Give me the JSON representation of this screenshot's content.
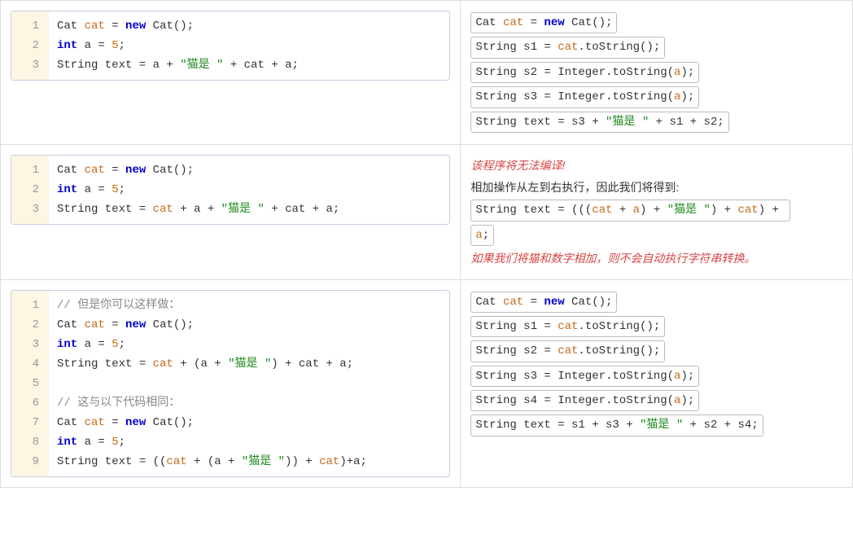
{
  "rows": [
    {
      "left": {
        "lines": [
          [
            {
              "t": "Cat ",
              "c": "typ"
            },
            {
              "t": "cat",
              "c": "var"
            },
            {
              "t": " = ",
              "c": "op"
            },
            {
              "t": "new",
              "c": "kw"
            },
            {
              "t": " Cat();",
              "c": "typ"
            }
          ],
          [
            {
              "t": "int",
              "c": "kw"
            },
            {
              "t": " a = ",
              "c": "op"
            },
            {
              "t": "5",
              "c": "num"
            },
            {
              "t": ";",
              "c": "op"
            }
          ],
          [
            {
              "t": "String text = a + ",
              "c": "op"
            },
            {
              "t": "\"猫是 \"",
              "c": "str"
            },
            {
              "t": " + cat + a;",
              "c": "op"
            }
          ]
        ]
      },
      "right": [
        {
          "type": "code",
          "tokens": [
            {
              "t": "Cat ",
              "c": "typ"
            },
            {
              "t": "cat",
              "c": "var"
            },
            {
              "t": " = ",
              "c": "op"
            },
            {
              "t": "new",
              "c": "kw"
            },
            {
              "t": " Cat();",
              "c": "typ"
            }
          ]
        },
        {
          "type": "code",
          "tokens": [
            {
              "t": "String s1 = ",
              "c": "op"
            },
            {
              "t": "cat",
              "c": "var"
            },
            {
              "t": ".toString();",
              "c": "op"
            }
          ]
        },
        {
          "type": "code",
          "tokens": [
            {
              "t": "String s2 = Integer.toString(",
              "c": "op"
            },
            {
              "t": "a",
              "c": "var"
            },
            {
              "t": ");",
              "c": "op"
            }
          ]
        },
        {
          "type": "code",
          "tokens": [
            {
              "t": "String s3 = Integer.toString(",
              "c": "op"
            },
            {
              "t": "a",
              "c": "var"
            },
            {
              "t": ");",
              "c": "op"
            }
          ]
        },
        {
          "type": "code",
          "tokens": [
            {
              "t": "String text = s3 + ",
              "c": "op"
            },
            {
              "t": "\"猫是 \"",
              "c": "str"
            },
            {
              "t": " + s1 + s2;",
              "c": "op"
            }
          ]
        }
      ]
    },
    {
      "left": {
        "lines": [
          [
            {
              "t": "Cat ",
              "c": "typ"
            },
            {
              "t": "cat",
              "c": "var"
            },
            {
              "t": " = ",
              "c": "op"
            },
            {
              "t": "new",
              "c": "kw"
            },
            {
              "t": " Cat();",
              "c": "typ"
            }
          ],
          [
            {
              "t": "int",
              "c": "kw"
            },
            {
              "t": " a = ",
              "c": "op"
            },
            {
              "t": "5",
              "c": "num"
            },
            {
              "t": ";",
              "c": "op"
            }
          ],
          [
            {
              "t": "String text = ",
              "c": "op"
            },
            {
              "t": "cat",
              "c": "var"
            },
            {
              "t": " + a + ",
              "c": "op"
            },
            {
              "t": "\"猫是 \"",
              "c": "str"
            },
            {
              "t": " + cat + a;",
              "c": "op"
            }
          ]
        ]
      },
      "right": [
        {
          "type": "err",
          "text": "该程序将无法编译!"
        },
        {
          "type": "plain",
          "text": "相加操作从左到右执行，因此我们将得到:"
        },
        {
          "type": "code",
          "tokens": [
            {
              "t": "String text = (((",
              "c": "op"
            },
            {
              "t": "cat",
              "c": "var"
            },
            {
              "t": " + ",
              "c": "op"
            },
            {
              "t": "a",
              "c": "var"
            },
            {
              "t": ") + ",
              "c": "op"
            },
            {
              "t": "\"猫是 \"",
              "c": "str"
            },
            {
              "t": ") + ",
              "c": "op"
            },
            {
              "t": "cat",
              "c": "var"
            },
            {
              "t": ") + ",
              "c": "op"
            }
          ]
        },
        {
          "type": "code",
          "tokens": [
            {
              "t": "a",
              "c": "var"
            },
            {
              "t": ";",
              "c": "op"
            }
          ]
        },
        {
          "type": "err",
          "text": "如果我们将猫和数字相加，则不会自动执行字符串转换。"
        }
      ]
    },
    {
      "left": {
        "lines": [
          [
            {
              "t": "// 但是你可以这样做：",
              "c": "cmt"
            }
          ],
          [
            {
              "t": "Cat ",
              "c": "typ"
            },
            {
              "t": "cat",
              "c": "var"
            },
            {
              "t": " = ",
              "c": "op"
            },
            {
              "t": "new",
              "c": "kw"
            },
            {
              "t": " Cat();",
              "c": "typ"
            }
          ],
          [
            {
              "t": "int",
              "c": "kw"
            },
            {
              "t": " a = ",
              "c": "op"
            },
            {
              "t": "5",
              "c": "num"
            },
            {
              "t": ";",
              "c": "op"
            }
          ],
          [
            {
              "t": "String text = ",
              "c": "op"
            },
            {
              "t": "cat",
              "c": "var"
            },
            {
              "t": " + (a + ",
              "c": "op"
            },
            {
              "t": "\"猫是 \"",
              "c": "str"
            },
            {
              "t": ") + cat + a;",
              "c": "op"
            }
          ],
          [
            {
              "t": " ",
              "c": "op"
            }
          ],
          [
            {
              "t": "// 这与以下代码相同：",
              "c": "cmt"
            }
          ],
          [
            {
              "t": "Cat ",
              "c": "typ"
            },
            {
              "t": "cat",
              "c": "var"
            },
            {
              "t": " = ",
              "c": "op"
            },
            {
              "t": "new",
              "c": "kw"
            },
            {
              "t": " Cat();",
              "c": "typ"
            }
          ],
          [
            {
              "t": "int",
              "c": "kw"
            },
            {
              "t": " a = ",
              "c": "op"
            },
            {
              "t": "5",
              "c": "num"
            },
            {
              "t": ";",
              "c": "op"
            }
          ],
          [
            {
              "t": "String text = ((",
              "c": "op"
            },
            {
              "t": "cat",
              "c": "var"
            },
            {
              "t": " + (a + ",
              "c": "op"
            },
            {
              "t": "\"猫是 \"",
              "c": "str"
            },
            {
              "t": ")) + ",
              "c": "op"
            },
            {
              "t": "cat",
              "c": "var"
            },
            {
              "t": ")+a;",
              "c": "op"
            }
          ]
        ]
      },
      "right": [
        {
          "type": "code",
          "tokens": [
            {
              "t": "Cat ",
              "c": "typ"
            },
            {
              "t": "cat",
              "c": "var"
            },
            {
              "t": " = ",
              "c": "op"
            },
            {
              "t": "new",
              "c": "kw"
            },
            {
              "t": " Cat();",
              "c": "typ"
            }
          ]
        },
        {
          "type": "code",
          "tokens": [
            {
              "t": "String s1 = ",
              "c": "op"
            },
            {
              "t": "cat",
              "c": "var"
            },
            {
              "t": ".toString();",
              "c": "op"
            }
          ]
        },
        {
          "type": "code",
          "tokens": [
            {
              "t": "String s2 = ",
              "c": "op"
            },
            {
              "t": "cat",
              "c": "var"
            },
            {
              "t": ".toString();",
              "c": "op"
            }
          ]
        },
        {
          "type": "code",
          "tokens": [
            {
              "t": "String s3 = Integer.toString(",
              "c": "op"
            },
            {
              "t": "a",
              "c": "var"
            },
            {
              "t": ");",
              "c": "op"
            }
          ]
        },
        {
          "type": "code",
          "tokens": [
            {
              "t": "String s4 = Integer.toString(",
              "c": "op"
            },
            {
              "t": "a",
              "c": "var"
            },
            {
              "t": ");",
              "c": "op"
            }
          ]
        },
        {
          "type": "code",
          "tokens": [
            {
              "t": "String text = s1 + s3 + ",
              "c": "op"
            },
            {
              "t": "\"猫是 \"",
              "c": "str"
            },
            {
              "t": " + s2 + s4;",
              "c": "op"
            }
          ]
        }
      ]
    }
  ]
}
